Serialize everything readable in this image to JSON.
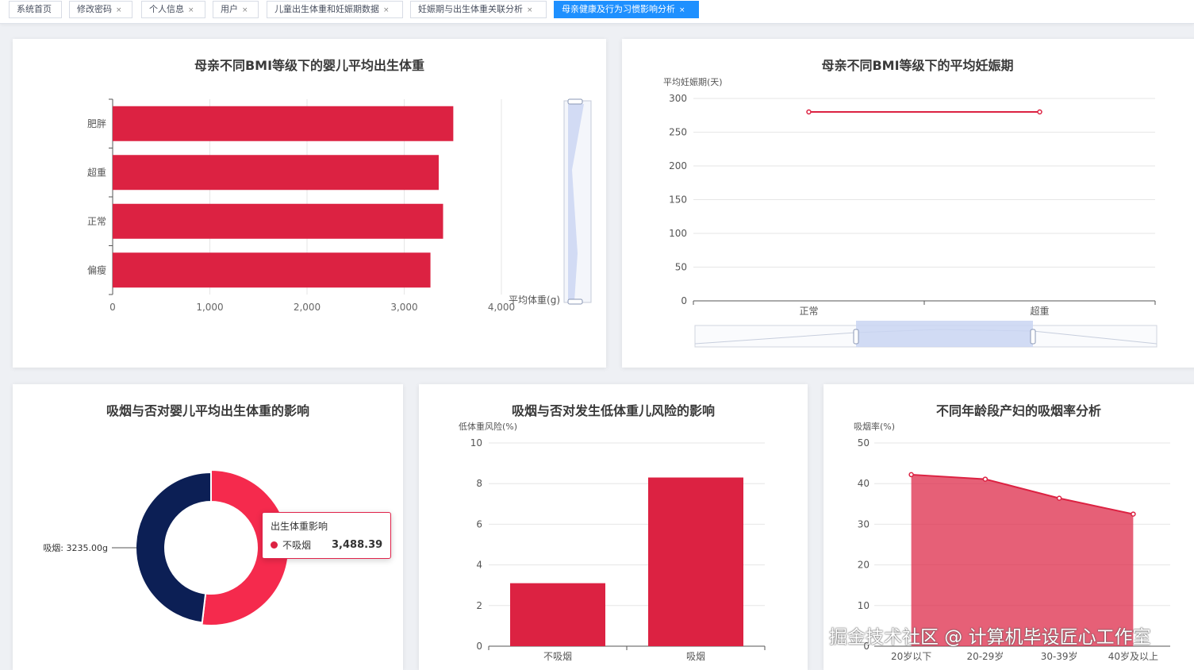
{
  "tabs": [
    {
      "label": "系统首页",
      "closable": false
    },
    {
      "label": "修改密码",
      "closable": true
    },
    {
      "label": "个人信息",
      "closable": true
    },
    {
      "label": "用户",
      "closable": true
    },
    {
      "label": "儿童出生体重和妊娠期数据",
      "closable": true
    },
    {
      "label": "妊娠期与出生体重关联分析",
      "closable": true
    },
    {
      "label": "母亲健康及行为习惯影响分析",
      "closable": true,
      "active": true
    }
  ],
  "close_glyph": "×",
  "colors": {
    "primary_red": "#dc2242",
    "navy": "#0c1f55",
    "pink_red": "#f52a4d",
    "active_tab": "#1e90ff",
    "zoom_blue": "#c9d5f2"
  },
  "chart_data": [
    {
      "type": "bar",
      "orientation": "horizontal",
      "title": "母亲不同BMI等级下的婴儿平均出生体重",
      "categories": [
        "肥胖",
        "超重",
        "正常",
        "偏瘦"
      ],
      "values": [
        3505,
        3355,
        3400,
        3270
      ],
      "xlabel": "平均体重(g)",
      "xlim": [
        0,
        4000
      ],
      "xticks": [
        "0",
        "1,000",
        "2,000",
        "3,000",
        "4,000"
      ],
      "has_vertical_zoom_slider": true,
      "grid": true
    },
    {
      "type": "line",
      "title": "母亲不同BMI等级下的平均妊娠期",
      "categories": [
        "正常",
        "超重"
      ],
      "values": [
        280,
        280
      ],
      "ylabel": "平均妊娠期(天)",
      "ylim": [
        0,
        300
      ],
      "yticks": [
        "0",
        "50",
        "100",
        "150",
        "200",
        "250",
        "300"
      ],
      "has_horizontal_zoom_slider": true,
      "grid": true
    },
    {
      "type": "pie",
      "style": "donut",
      "title": "吸烟与否对婴儿平均出生体重的影响",
      "slices": [
        {
          "name": "不吸烟",
          "value": 3488.39
        },
        {
          "name": "吸烟",
          "value": 3235.0
        }
      ],
      "label": "吸烟: 3235.00g",
      "tooltip": {
        "title": "出生体重影响",
        "name": "不吸烟",
        "value": "3,488.39"
      }
    },
    {
      "type": "bar",
      "title": "吸烟与否对发生低体重儿风险的影响",
      "categories": [
        "不吸烟",
        "吸烟"
      ],
      "values": [
        3.1,
        8.3
      ],
      "ylabel": "低体重风险(%)",
      "ylim": [
        0,
        10
      ],
      "yticks": [
        "0",
        "2",
        "4",
        "6",
        "8",
        "10"
      ],
      "grid": true
    },
    {
      "type": "area",
      "title": "不同年龄段产妇的吸烟率分析",
      "categories": [
        "20岁以下",
        "20-29岁",
        "30-39岁",
        "40岁及以上"
      ],
      "values": [
        42.2,
        41.1,
        36.4,
        32.5
      ],
      "ylabel": "吸烟率(%)",
      "ylim": [
        0,
        50
      ],
      "yticks": [
        "0",
        "10",
        "20",
        "30",
        "40",
        "50"
      ],
      "grid": true
    }
  ],
  "watermark": "掘金技术社区 @ 计算机毕设匠心工作室"
}
